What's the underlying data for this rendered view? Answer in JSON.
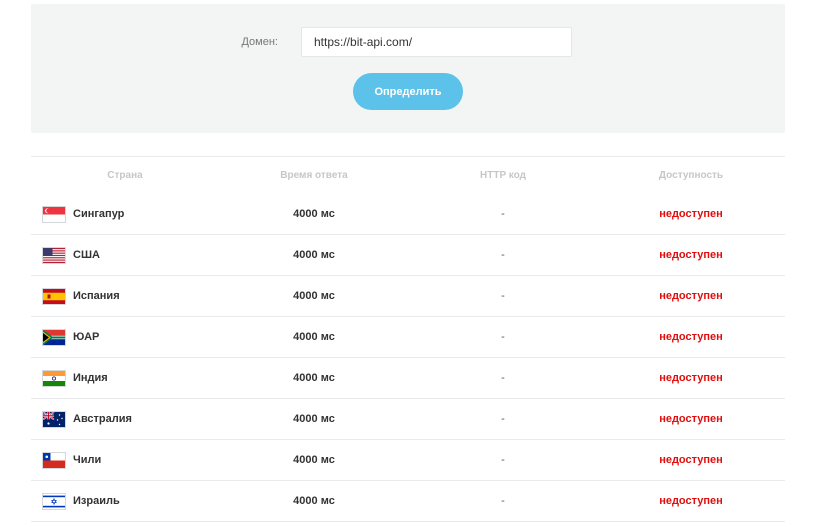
{
  "form": {
    "domain_label": "Домен:",
    "domain_value": "https://bit-api.com/",
    "submit_label": "Определить"
  },
  "colors": {
    "panel_bg": "#f3f5f5",
    "button_bg": "#5cc2ea",
    "status_unavailable": "#e00f0f",
    "header_text": "#c4c7c9"
  },
  "table": {
    "headers": [
      "Страна",
      "Время ответа",
      "HTTP код",
      "Доступность"
    ],
    "rows": [
      {
        "flag": "singapore-flag",
        "country": "Сингапур",
        "time": "4000 мс",
        "code": "-",
        "status": "недоступен"
      },
      {
        "flag": "usa-flag",
        "country": "США",
        "time": "4000 мс",
        "code": "-",
        "status": "недоступен"
      },
      {
        "flag": "spain-flag",
        "country": "Испания",
        "time": "4000 мс",
        "code": "-",
        "status": "недоступен"
      },
      {
        "flag": "south-africa-flag",
        "country": "ЮАР",
        "time": "4000 мс",
        "code": "-",
        "status": "недоступен"
      },
      {
        "flag": "india-flag",
        "country": "Индия",
        "time": "4000 мс",
        "code": "-",
        "status": "недоступен"
      },
      {
        "flag": "australia-flag",
        "country": "Австралия",
        "time": "4000 мс",
        "code": "-",
        "status": "недоступен"
      },
      {
        "flag": "chile-flag",
        "country": "Чили",
        "time": "4000 мс",
        "code": "-",
        "status": "недоступен"
      },
      {
        "flag": "israel-flag",
        "country": "Израиль",
        "time": "4000 мс",
        "code": "-",
        "status": "недоступен"
      }
    ]
  }
}
